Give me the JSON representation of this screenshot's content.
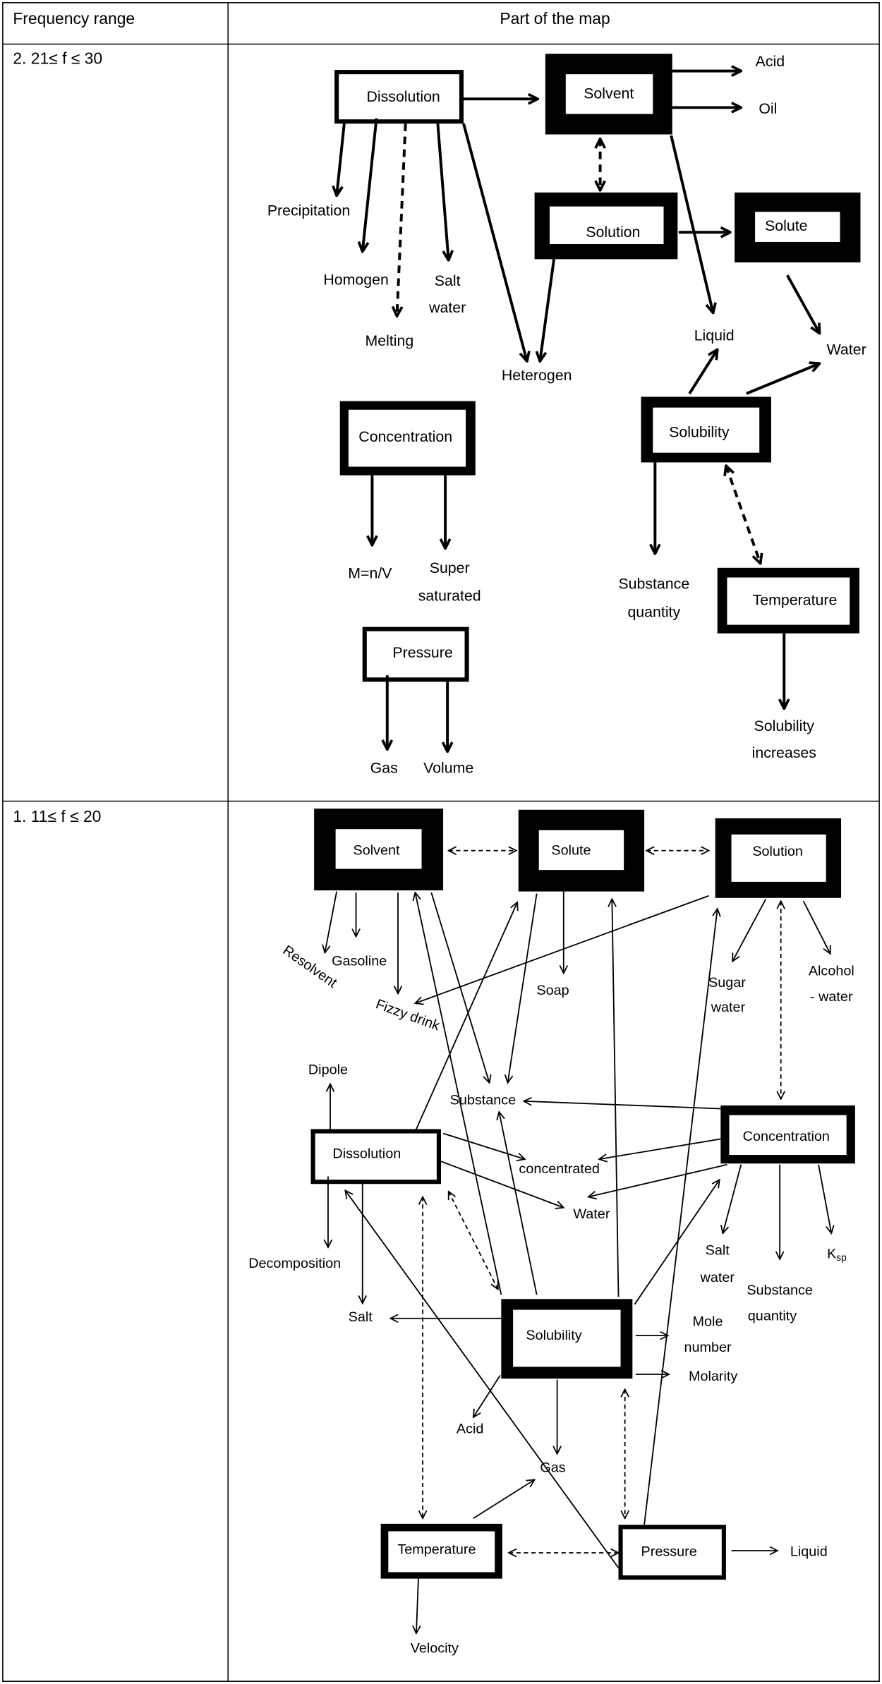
{
  "table": {
    "headers": [
      "Frequency range",
      "Part of the map"
    ],
    "rows": [
      {
        "range": "2. 21≤ f ≤ 30"
      },
      {
        "range": "1. 11≤ f ≤ 20"
      }
    ]
  },
  "map_top": {
    "dissolution": "Dissolution",
    "solvent": "Solvent",
    "acid": "Acid",
    "oil": "Oil",
    "solution": "Solution",
    "solute": "Solute",
    "liquid": "Liquid",
    "water": "Water",
    "precipitation": "Precipitation",
    "homogen": "Homogen",
    "melting": "Melting",
    "salt": "Salt",
    "salt_water": "water",
    "heterogen": "Heterogen",
    "concentration": "Concentration",
    "mnv": "M=n/V",
    "super": "Super",
    "saturated": "saturated",
    "pressure": "Pressure",
    "gas": "Gas",
    "volume": "Volume",
    "solubility": "Solubility",
    "substance": "Substance",
    "quantity": "quantity",
    "temperature": "Temperature",
    "solubility2": "Solubility",
    "increases": "increases"
  },
  "map_bottom": {
    "solvent": "Solvent",
    "solute": "Solute",
    "solution": "Solution",
    "resolvent": "Resolvent",
    "gasoline": "Gasoline",
    "fizzy_drink": "Fizzy drink",
    "soap": "Soap",
    "sugar": "Sugar",
    "sugar_water": "water",
    "alcohol": "Alcohol",
    "alcohol_water": "- water",
    "dipole": "Dipole",
    "substance": "Substance",
    "concentration": "Concentration",
    "dissolution": "Dissolution",
    "concentrated": "concentrated",
    "water": "Water",
    "decomposition": "Decomposition",
    "salt": "Salt",
    "salt2": "Salt",
    "salt2_water": "water",
    "substance2": "Substance",
    "quantity": "quantity",
    "k": "K",
    "sp": "sp",
    "solubility": "Solubility",
    "mole": "Mole",
    "number": "number",
    "molarity": "Molarity",
    "acid": "Acid",
    "gas": "Gas",
    "temperature": "Temperature",
    "pressure": "Pressure",
    "liquid": "Liquid",
    "velocity": "Velocity"
  }
}
